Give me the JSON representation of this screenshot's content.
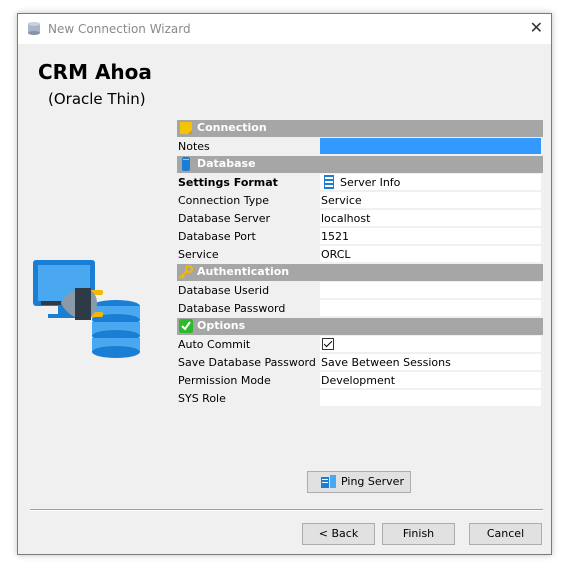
{
  "window": {
    "title": "New Connection Wizard"
  },
  "header": {
    "title": "CRM Ahoa",
    "subtitle": "(Oracle Thin)"
  },
  "sections": {
    "connection": "Connection",
    "database": "Database",
    "authentication": "Authentication",
    "options": "Options"
  },
  "fields": {
    "notes": {
      "label": "Notes",
      "value": ""
    },
    "settings_format": {
      "label": "Settings Format",
      "value": "Server Info"
    },
    "connection_type": {
      "label": "Connection Type",
      "value": "Service"
    },
    "database_server": {
      "label": "Database Server",
      "value": "localhost"
    },
    "database_port": {
      "label": "Database Port",
      "value": "1521"
    },
    "service": {
      "label": "Service",
      "value": "ORCL"
    },
    "database_userid": {
      "label": "Database Userid",
      "value": ""
    },
    "database_password": {
      "label": "Database Password",
      "value": ""
    },
    "auto_commit": {
      "label": "Auto Commit",
      "checked": true
    },
    "save_db_password": {
      "label": "Save Database Password",
      "value": "Save Between Sessions"
    },
    "permission_mode": {
      "label": "Permission Mode",
      "value": "Development"
    },
    "sys_role": {
      "label": "SYS Role",
      "value": ""
    }
  },
  "buttons": {
    "ping": "Ping Server",
    "back": "< Back",
    "finish": "Finish",
    "cancel": "Cancel"
  },
  "icons": {
    "app": "database-icon",
    "close": "close-icon",
    "connection": "note-icon",
    "database": "database-cylinder-icon",
    "authentication": "key-icon",
    "options": "checkmark-icon",
    "settings_format": "server-info-icon",
    "ping": "ping-server-icon",
    "illustration": "computer-plug-database-icon"
  },
  "colors": {
    "section_bar": "#a6a6a6",
    "selected_field": "#3399ff",
    "options_icon": "#2eb82e"
  }
}
